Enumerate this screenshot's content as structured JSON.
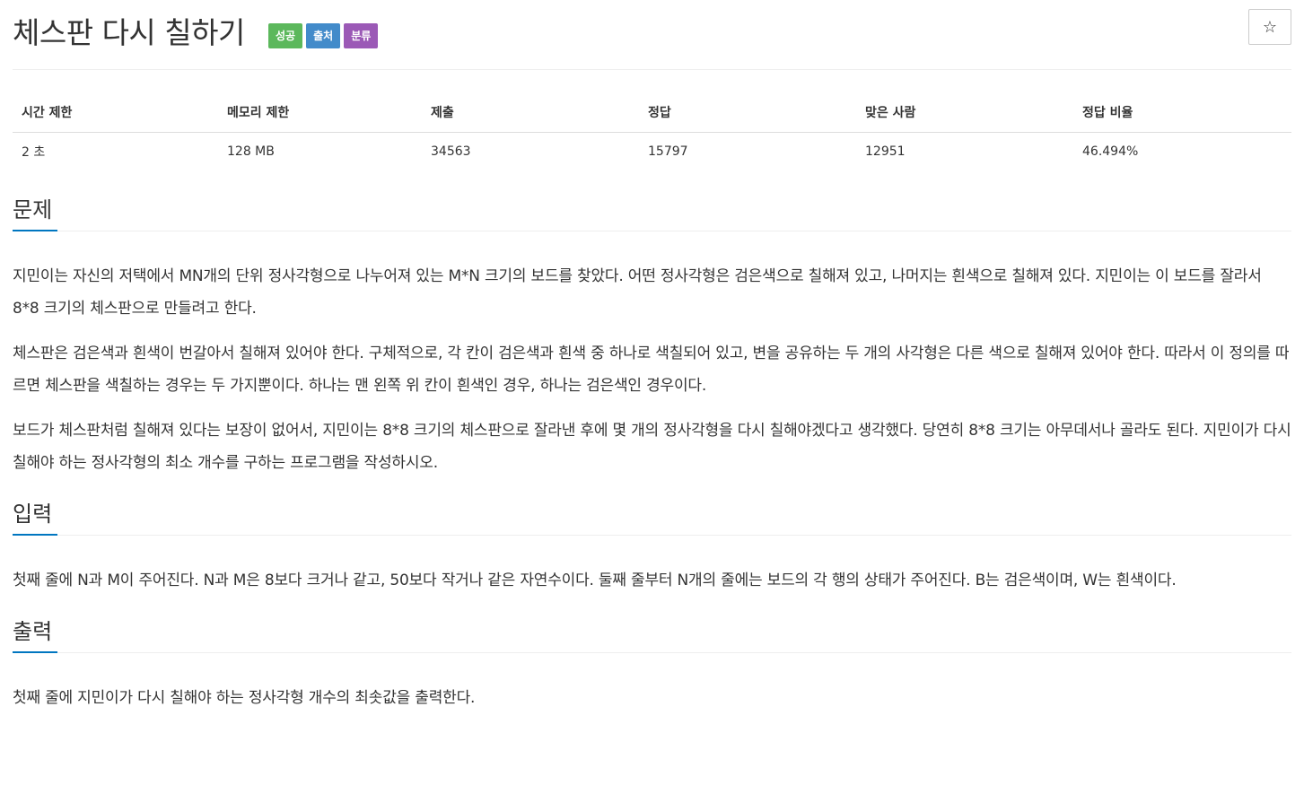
{
  "problem": {
    "title": "체스판 다시 칠하기",
    "badges": {
      "success": "성공",
      "source": "출처",
      "category": "분류"
    },
    "star_label": "☆"
  },
  "stats": {
    "headers": [
      "시간 제한",
      "메모리 제한",
      "제출",
      "정답",
      "맞은 사람",
      "정답 비율"
    ],
    "values": [
      "2 초",
      "128 MB",
      "34563",
      "15797",
      "12951",
      "46.494%"
    ]
  },
  "sections": {
    "problem": {
      "heading": "문제",
      "paragraphs": [
        "지민이는 자신의 저택에서 MN개의 단위 정사각형으로 나누어져 있는 M*N 크기의 보드를 찾았다. 어떤 정사각형은 검은색으로 칠해져 있고, 나머지는 흰색으로 칠해져 있다. 지민이는 이 보드를 잘라서 8*8 크기의 체스판으로 만들려고 한다.",
        "체스판은 검은색과 흰색이 번갈아서 칠해져 있어야 한다. 구체적으로, 각 칸이 검은색과 흰색 중 하나로 색칠되어 있고, 변을 공유하는 두 개의 사각형은 다른 색으로 칠해져 있어야 한다. 따라서 이 정의를 따르면 체스판을 색칠하는 경우는 두 가지뿐이다. 하나는 맨 왼쪽 위 칸이 흰색인 경우, 하나는 검은색인 경우이다.",
        "보드가 체스판처럼 칠해져 있다는 보장이 없어서, 지민이는 8*8 크기의 체스판으로 잘라낸 후에 몇 개의 정사각형을 다시 칠해야겠다고 생각했다. 당연히 8*8 크기는 아무데서나 골라도 된다. 지민이가 다시 칠해야 하는 정사각형의 최소 개수를 구하는 프로그램을 작성하시오."
      ]
    },
    "input": {
      "heading": "입력",
      "paragraphs": [
        "첫째 줄에 N과 M이 주어진다. N과 M은 8보다 크거나 같고, 50보다 작거나 같은 자연수이다. 둘째 줄부터 N개의 줄에는 보드의 각 행의 상태가 주어진다. B는 검은색이며, W는 흰색이다."
      ]
    },
    "output": {
      "heading": "출력",
      "paragraphs": [
        "첫째 줄에 지민이가 다시 칠해야 하는 정사각형 개수의 최솟값을 출력한다."
      ]
    }
  },
  "colors": {
    "success": "#5cb85c",
    "source": "#428bca",
    "category": "#9b59b6",
    "heading_underline": "#0076c0"
  }
}
